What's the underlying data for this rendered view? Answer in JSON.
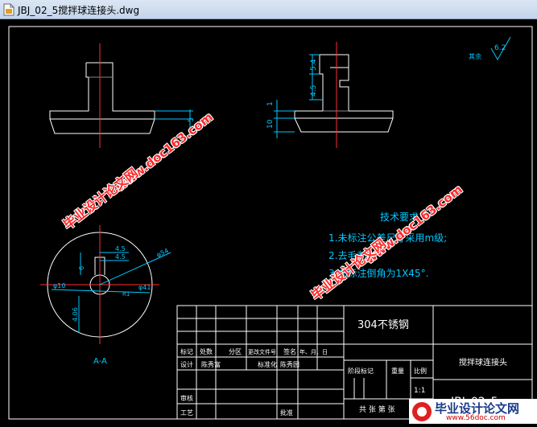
{
  "window": {
    "title": "JBJ_02_5搅拌球连接头.dwg"
  },
  "drawing": {
    "roughness_label": "其余",
    "roughness_value": "6.2",
    "section_label": "A-A",
    "dims": {
      "d5": "5",
      "d54": "5.4",
      "d45a": "4.5",
      "d10": "10",
      "d1": "1",
      "d45b": "4.5",
      "d45c": "4.5",
      "d6": "6",
      "d1b": "1",
      "phi54": "φ54",
      "phi10": "φ10",
      "phi41": "φ41",
      "d406": "4.06",
      "r1": "R1"
    },
    "tech_req": {
      "title": "技术要求",
      "items": [
        "1.未标注公差尺寸采用m级;",
        "2.去毛刺;",
        "3.未标注倒角为1X45°."
      ]
    },
    "title_block": {
      "material": "304不锈钢",
      "part_name": "搅拌球连接头",
      "drawing_no": "JBJ_02_5",
      "scale": "1:1",
      "rev_headers": [
        "标记",
        "处数",
        "分区",
        "更改文件号",
        "签名",
        "年、月、日"
      ],
      "row_design": [
        "设计",
        "陈秀富",
        "标准化",
        "陈秀园"
      ],
      "stage_headers": [
        "阶段标记",
        "重量",
        "比例"
      ],
      "review": "审核",
      "process": "工艺",
      "approve": "批准",
      "sheets": "共 张 第 张"
    }
  },
  "watermarks": {
    "site": "www.doc163.com",
    "brand": "毕业设计论文网",
    "logo_text": "毕业设计论文网",
    "logo_url": "www.56doc.com"
  }
}
